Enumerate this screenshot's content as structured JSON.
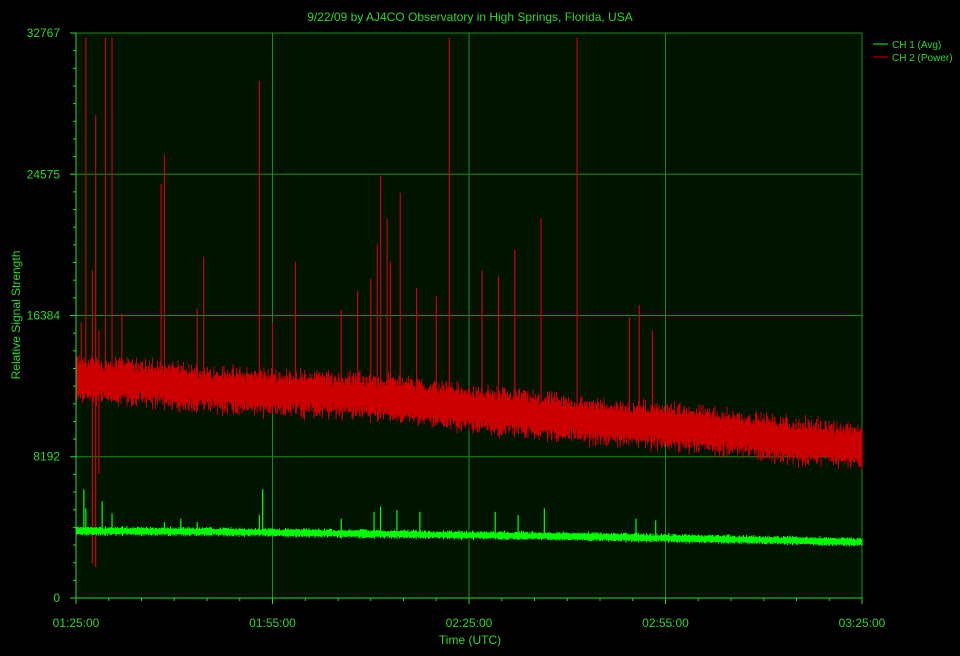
{
  "colors": {
    "background": "#000000",
    "plot_background": "#001400",
    "grid": "#1e8a1e",
    "text": "#2fd62f",
    "ch1": "#00ff00",
    "ch2": "#cc0000"
  },
  "chart_data": {
    "type": "line",
    "title": "9/22/09  by  AJ4CO Observatory  in  High Springs, Florida, USA",
    "xlabel": "Time (UTC)",
    "ylabel": "Relative Signal Strength",
    "x_unit": "minutes after 01:25:00 UTC",
    "xlim": [
      0,
      120
    ],
    "ylim": [
      0,
      32767
    ],
    "x_ticks": [
      {
        "value": 0,
        "label": "01:25:00"
      },
      {
        "value": 30,
        "label": "01:55:00"
      },
      {
        "value": 60,
        "label": "02:25:00"
      },
      {
        "value": 90,
        "label": "02:55:00"
      },
      {
        "value": 120,
        "label": "03:25:00"
      }
    ],
    "y_ticks": [
      {
        "value": 0,
        "label": "0"
      },
      {
        "value": 8192,
        "label": "8192"
      },
      {
        "value": 16384,
        "label": "16384"
      },
      {
        "value": 24575,
        "label": "24575"
      },
      {
        "value": 32767,
        "label": "32767"
      }
    ],
    "grid": true,
    "legend_position": "top-right",
    "series": [
      {
        "name": "CH 1 (Avg)",
        "color": "#00ff00",
        "baseline": [
          [
            0,
            3900
          ],
          [
            20,
            3850
          ],
          [
            40,
            3750
          ],
          [
            60,
            3650
          ],
          [
            80,
            3550
          ],
          [
            100,
            3400
          ],
          [
            120,
            3250
          ]
        ],
        "band_halfwidth": 300,
        "spikes": [
          [
            1.2,
            6300
          ],
          [
            1.5,
            5200
          ],
          [
            4.0,
            5600
          ],
          [
            5.5,
            4900
          ],
          [
            13.5,
            4400
          ],
          [
            16.0,
            4600
          ],
          [
            18.5,
            4400
          ],
          [
            28.0,
            4800
          ],
          [
            28.5,
            6300
          ],
          [
            40.5,
            4600
          ],
          [
            45.5,
            5000
          ],
          [
            46.5,
            5300
          ],
          [
            49.0,
            5100
          ],
          [
            52.5,
            5000
          ],
          [
            64.0,
            5000
          ],
          [
            67.5,
            4800
          ],
          [
            71.5,
            5200
          ],
          [
            85.5,
            4600
          ],
          [
            88.5,
            4500
          ]
        ]
      },
      {
        "name": "CH 2 (Power)",
        "color": "#cc0000",
        "baseline": [
          [
            0,
            12700
          ],
          [
            10,
            12500
          ],
          [
            20,
            12100
          ],
          [
            30,
            11900
          ],
          [
            40,
            11800
          ],
          [
            50,
            11500
          ],
          [
            60,
            11000
          ],
          [
            70,
            10600
          ],
          [
            80,
            10200
          ],
          [
            90,
            10000
          ],
          [
            100,
            9600
          ],
          [
            110,
            9100
          ],
          [
            120,
            8800
          ]
        ],
        "band_halfwidth": 1600,
        "spikes": [
          [
            0.8,
            16000
          ],
          [
            1.5,
            32500
          ],
          [
            2.5,
            19000
          ],
          [
            3.0,
            28000
          ],
          [
            3.5,
            15500
          ],
          [
            4.5,
            32500
          ],
          [
            5.5,
            32500
          ],
          [
            7.0,
            16500
          ],
          [
            13.0,
            24000
          ],
          [
            13.5,
            25700
          ],
          [
            18.5,
            16800
          ],
          [
            19.5,
            19800
          ],
          [
            28.0,
            30000
          ],
          [
            30.0,
            16000
          ],
          [
            33.5,
            19500
          ],
          [
            40.5,
            16700
          ],
          [
            43.0,
            17800
          ],
          [
            45.0,
            18500
          ],
          [
            46.0,
            20500
          ],
          [
            46.5,
            24500
          ],
          [
            47.5,
            22000
          ],
          [
            48.0,
            19500
          ],
          [
            49.5,
            23500
          ],
          [
            52.0,
            18000
          ],
          [
            55.0,
            17500
          ],
          [
            57.0,
            32500
          ],
          [
            62.0,
            19000
          ],
          [
            64.5,
            18700
          ],
          [
            67.0,
            20200
          ],
          [
            71.0,
            22000
          ],
          [
            76.5,
            32500
          ],
          [
            84.5,
            16300
          ],
          [
            86.0,
            17000
          ],
          [
            88.0,
            15500
          ]
        ],
        "dips": [
          [
            2.5,
            2000
          ],
          [
            3.0,
            1800
          ],
          [
            3.5,
            7200
          ]
        ]
      }
    ]
  }
}
